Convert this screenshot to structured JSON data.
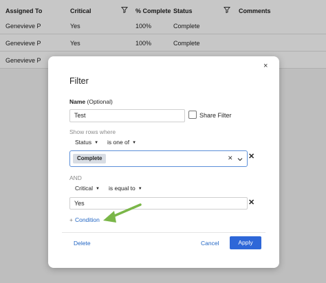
{
  "grid": {
    "columns": [
      {
        "label": "Assigned To",
        "filter": false
      },
      {
        "label": "Critical",
        "filter": true
      },
      {
        "label": "% Complete",
        "filter": false
      },
      {
        "label": "Status",
        "filter": true
      },
      {
        "label": "Comments",
        "filter": false
      }
    ],
    "rows": [
      [
        "Genevieve P",
        "Yes",
        "100%",
        "Complete",
        ""
      ],
      [
        "Genevieve P",
        "Yes",
        "100%",
        "Complete",
        ""
      ],
      [
        "Genevieve P",
        "",
        "",
        "",
        ""
      ]
    ]
  },
  "modal": {
    "title": "Filter",
    "close_glyph": "×",
    "name_label_bold": "Name",
    "name_label_optional": " (Optional)",
    "name_value": "Test",
    "share_filter_label": "Share Filter",
    "share_filter_checked": false,
    "show_rows_label": "Show rows where",
    "conditions": [
      {
        "field": "Status",
        "operator": "is one of",
        "selected_values": [
          "Complete"
        ]
      },
      {
        "field": "Critical",
        "operator": "is equal to",
        "value": "Yes"
      }
    ],
    "and_label": "AND",
    "add_condition_label": "Condition",
    "add_condition_plus": "+",
    "delete_label": "Delete",
    "cancel_label": "Cancel",
    "apply_label": "Apply"
  },
  "colors": {
    "accent": "#2e67d8",
    "link": "#2266c4",
    "annotation_arrow": "#7ab648"
  }
}
